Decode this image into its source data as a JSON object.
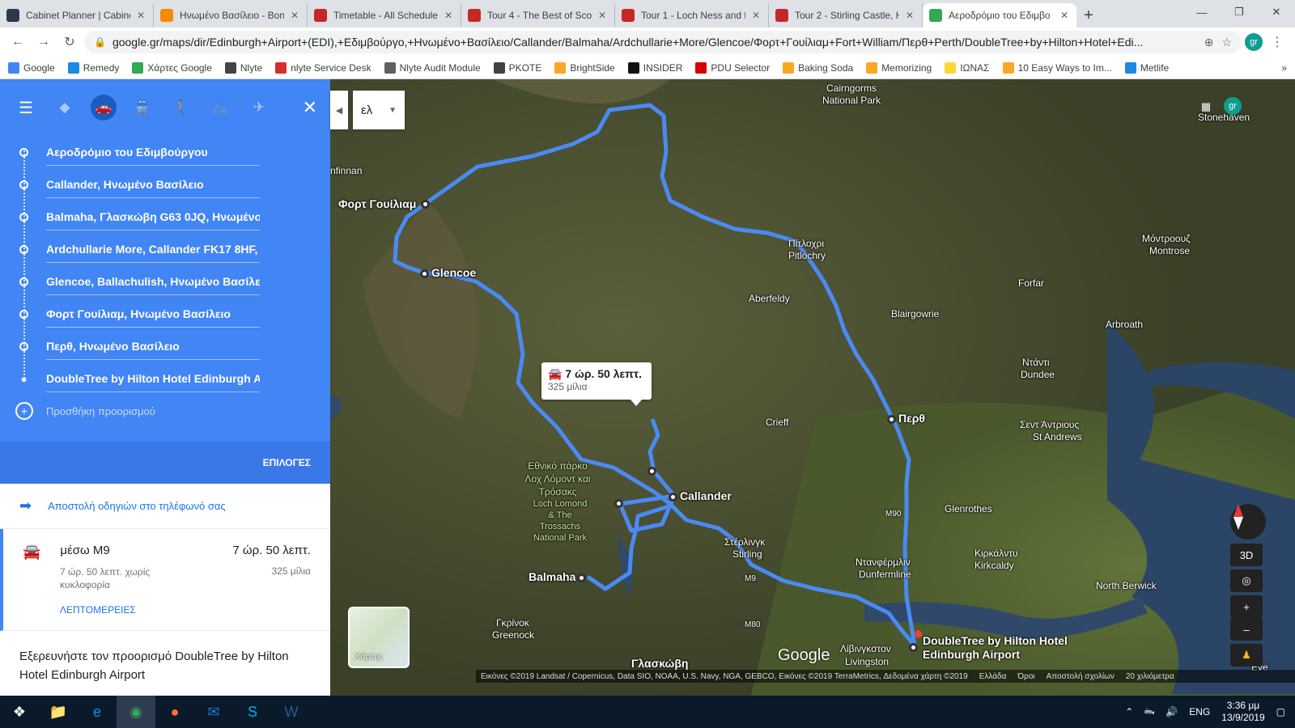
{
  "tabs": [
    {
      "title": "Cabinet Planner | Cabinet",
      "favicon_color": "#2b3a4a",
      "icon": "gear-icon"
    },
    {
      "title": "Ηνωμένο Βασίλειο - Bon",
      "favicon_color": "#f28b00",
      "icon": "plane-icon"
    },
    {
      "title": "Timetable - All Schedules",
      "favicon_color": "#c62828",
      "icon": "globe-icon"
    },
    {
      "title": "Tour 4 - The Best of Scot",
      "favicon_color": "#c62828",
      "icon": "globe-icon"
    },
    {
      "title": "Tour 1 - Loch Ness and th",
      "favicon_color": "#c62828",
      "icon": "globe-icon"
    },
    {
      "title": "Tour 2 - Stirling Castle, H",
      "favicon_color": "#c62828",
      "icon": "globe-icon"
    },
    {
      "title": "Αεροδρόμιο του Εδιμβο",
      "favicon_color": "#34a853",
      "icon": "maps-icon"
    }
  ],
  "url": "google.gr/maps/dir/Edinburgh+Airport+(EDI),+Εδιμβούργο,+Ηνωμένο+Βασίλειο/Callander/Balmaha/Ardchullarie+More/Glencoe/Φορτ+Γουίλιαμ+Fort+William/Περθ+Perth/DoubleTree+by+Hilton+Hotel+Edi...",
  "profile_initials": "gr",
  "bookmarks": [
    {
      "label": "Google",
      "color": "#4285f4"
    },
    {
      "label": "Remedy",
      "color": "#1e88e5"
    },
    {
      "label": "Χάρτες Google",
      "color": "#34a853"
    },
    {
      "label": "Nlyte",
      "color": "#444444"
    },
    {
      "label": "nlyte Service Desk",
      "color": "#d32f2f"
    },
    {
      "label": "Nlyte Audit Module",
      "color": "#616161"
    },
    {
      "label": "PKOTE",
      "color": "#424242"
    },
    {
      "label": "BrightSide",
      "color": "#f9a825"
    },
    {
      "label": "INSIDER",
      "color": "#111111"
    },
    {
      "label": "PDU Selector",
      "color": "#d50000"
    },
    {
      "label": "Baking Soda",
      "color": "#f9a825"
    },
    {
      "label": "Memorizing",
      "color": "#f9a825"
    },
    {
      "label": "ΙΩΝΑΣ",
      "color": "#fdd835"
    },
    {
      "label": "10 Easy Ways to Im...",
      "color": "#f9a825"
    },
    {
      "label": "Metlife",
      "color": "#1e88e5"
    }
  ],
  "stops": [
    "Αεροδρόμιο του Εδιμβούργου",
    "Callander, Ηνωμένο Βασίλειο",
    "Balmaha, Γλασκώβη G63 0JQ, Ηνωμένο",
    "Ardchullarie More, Callander FK17 8HF,",
    "Glencoe, Ballachulish, Ηνωμένο Βασίλειο",
    "Φορτ Γουίλιαμ, Ηνωμένο Βασίλειο",
    "Περθ, Ηνωμένο Βασίλειο",
    "DoubleTree by Hilton Hotel Edinburgh Airport"
  ],
  "add_destination": "Προσθήκη προορισμού",
  "options": "ΕΠΙΛΟΓΕΣ",
  "send_to_phone": "Αποστολή οδηγιών στο τηλέφωνό σας",
  "route": {
    "via": "μέσω M9",
    "time": "7 ώρ. 50 λεπτ.",
    "note": "7 ώρ. 50 λεπτ. χωρίς κυκλοφορία",
    "distance": "325 μίλια",
    "details": "ΛΕΠΤΟΜΕΡΕΙΕΣ"
  },
  "explore": "Εξερευνήστε τον προορισμό DoubleTree by Hilton Hotel Edinburgh Airport",
  "language": "ελ",
  "callout": {
    "time": "7 ώρ. 50 λεπτ.",
    "distance": "325 μίλια"
  },
  "map_labels": {
    "fort_william": "Φορτ Γουίλιαμ",
    "glencoe": "Glencoe",
    "callander": "Callander",
    "balmaha": "Balmaha",
    "perth": "Περθ",
    "hotel": "DoubleTree by Hilton Hotel Edinburgh Airport",
    "cairngorms": "Cairngorms National Park",
    "pitlochry_gr": "Πίτλοχρι",
    "pitlochry": "Pitlochry",
    "aberfeldy": "Aberfeldy",
    "blairgowrie": "Blairgowrie",
    "forfar": "Forfar",
    "montrose_gr": "Μόντροουζ",
    "montrose": "Montrose",
    "arbroath": "Arbroath",
    "dundee_gr": "Ντάντι",
    "dundee": "Dundee",
    "crieff": "Crieff",
    "st_andrews_gr": "Σεντ Άντριους",
    "st_andrews": "St Andrews",
    "glenrothes": "Glenrothes",
    "kirkcaldy_gr": "Κιρκάλντυ",
    "kirkcaldy": "Kirkcaldy",
    "dunfermline_gr": "Ντανφέρμλιν",
    "dunfermline": "Dunfermline",
    "stirling_gr": "Στέρλινγκ",
    "stirling": "Stirling",
    "north_berwick": "North Berwick",
    "livingston_gr": "Λίβινγκστον",
    "livingston": "Livingston",
    "glasgow": "Γλασκώβη",
    "greenock_gr": "Γκρίνοκ",
    "greenock": "Greenock",
    "stonehaven": "Stonehaven",
    "park": "Εθνικό πάρκο Λοχ Λόμοντ και Τρόσακς",
    "park_en": "Loch Lomond & The Trossachs National Park",
    "finnan": "nfinnan",
    "m90": "M90",
    "m9": "M9",
    "m80": "M80",
    "eve": "Eve"
  },
  "satellite_label": "Χάρτης",
  "google_logo": "Google",
  "btn_3d": "3D",
  "attribution": [
    "Εικόνες ©2019 Landsat / Copernicus, Data SIO, NOAA, U.S. Navy, NGA, GEBCO, Εικόνες ©2019 TerraMetrics, Δεδομένα χάρτη ©2019",
    "Ελλάδα",
    "Όροι",
    "Αποστολή σχολίων",
    "20 χιλιόμετρα"
  ],
  "taskbar": {
    "lang": "ENG",
    "time": "3:36 μμ",
    "date": "13/9/2019"
  },
  "colors": {
    "route": "#4a8af4",
    "panel": "#4285f4",
    "accent": "#1a73e8"
  }
}
